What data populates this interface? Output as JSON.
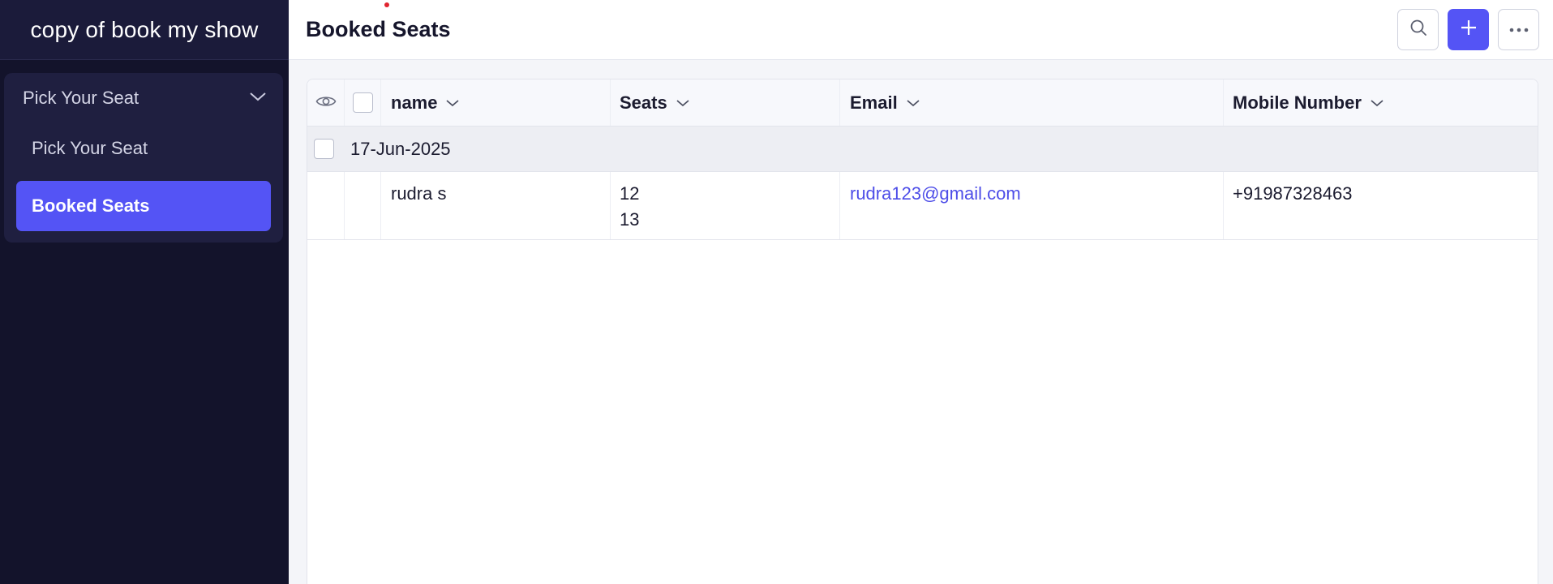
{
  "app": {
    "title": "copy of book my show"
  },
  "sidebar": {
    "group_label": "Pick Your Seat",
    "items": [
      {
        "label": "Pick Your Seat",
        "active": false
      },
      {
        "label": "Booked Seats",
        "active": true
      }
    ]
  },
  "header": {
    "title": "Booked Seats"
  },
  "actions": {
    "search_icon": "search-icon",
    "add_icon": "plus-icon",
    "more_icon": "more-horizontal-icon"
  },
  "colors": {
    "accent": "#5454f5",
    "sidebar_bg": "#13132b",
    "link": "#4d4de8"
  },
  "table": {
    "columns": [
      "name",
      "Seats",
      "Email",
      "Mobile Number"
    ],
    "group": {
      "label": "17-Jun-2025"
    },
    "rows": [
      {
        "name": "rudra s",
        "seats": [
          "12",
          "13"
        ],
        "email": "rudra123@gmail.com",
        "mobile": "+91987328463"
      }
    ]
  }
}
